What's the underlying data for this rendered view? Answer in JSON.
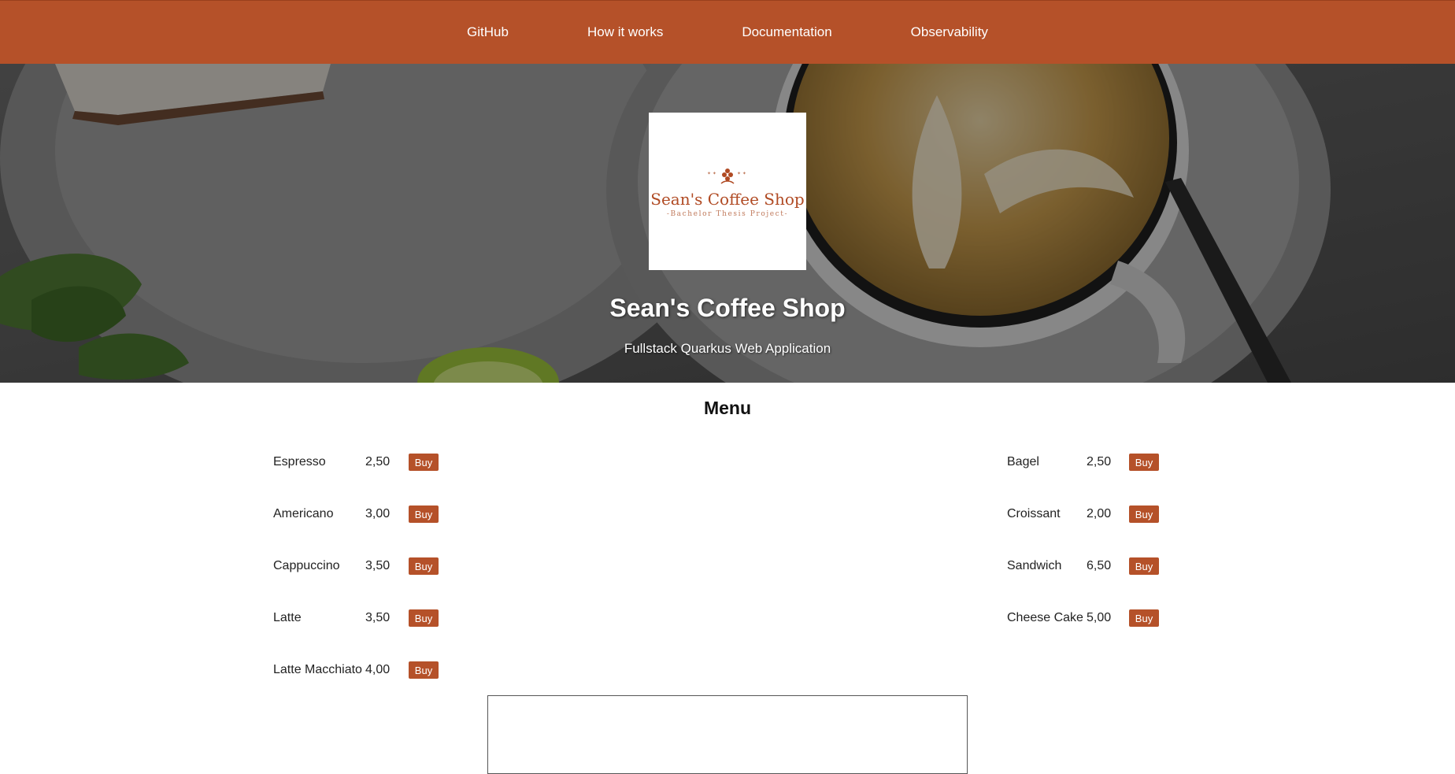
{
  "nav": {
    "links": [
      {
        "label": "GitHub"
      },
      {
        "label": "How it works"
      },
      {
        "label": "Documentation"
      },
      {
        "label": "Observability"
      }
    ]
  },
  "hero": {
    "logo_name": "Sean's Coffee Shop",
    "logo_subtitle": "-Bachelor Thesis Project-",
    "title": "Sean's Coffee Shop",
    "subtitle": "Fullstack Quarkus Web Application"
  },
  "menu": {
    "heading": "Menu",
    "buy_label": "Buy",
    "drinks": [
      {
        "name": "Espresso",
        "price": "2,50"
      },
      {
        "name": "Americano",
        "price": "3,00"
      },
      {
        "name": "Cappuccino",
        "price": "3,50"
      },
      {
        "name": "Latte",
        "price": "3,50"
      },
      {
        "name": "Latte Macchiato",
        "price": "4,00"
      }
    ],
    "foods": [
      {
        "name": "Bagel",
        "price": "2,50"
      },
      {
        "name": "Croissant",
        "price": "2,00"
      },
      {
        "name": "Sandwich",
        "price": "6,50"
      },
      {
        "name": "Cheese Cake",
        "price": "5,00"
      }
    ]
  },
  "colors": {
    "accent": "#b55129",
    "logo_text": "#b04a23"
  }
}
